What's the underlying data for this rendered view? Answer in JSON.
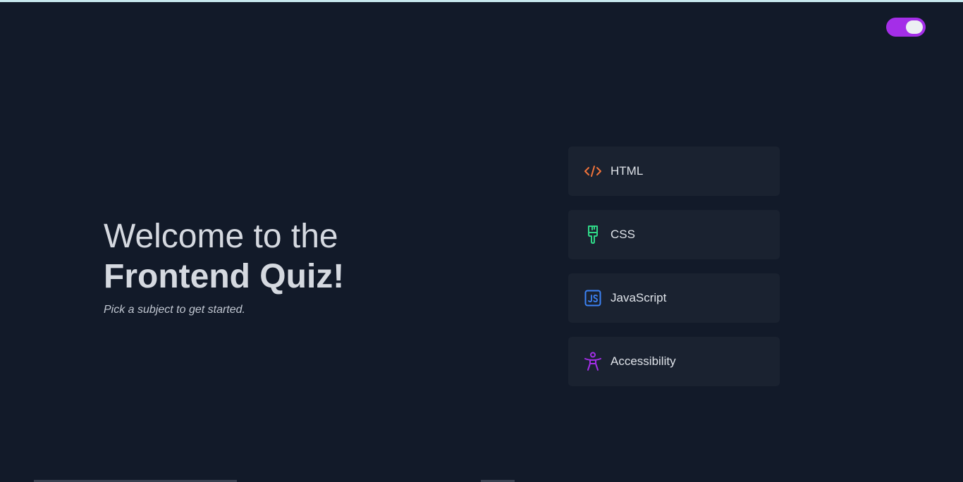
{
  "header": {
    "theme_toggle_state": "on",
    "accent_color": "#a42ee8"
  },
  "hero": {
    "title_line1": "Welcome to the",
    "title_line2": "Frontend Quiz!",
    "subtitle": "Pick a subject to get started."
  },
  "subjects": [
    {
      "label": "HTML",
      "icon": "code-icon",
      "color": "#f0733a"
    },
    {
      "label": "CSS",
      "icon": "paintbrush-icon",
      "color": "#2fd887"
    },
    {
      "label": "JavaScript",
      "icon": "js-icon",
      "color": "#3c83f6"
    },
    {
      "label": "Accessibility",
      "icon": "accessibility-icon",
      "color": "#a42ee8"
    }
  ]
}
